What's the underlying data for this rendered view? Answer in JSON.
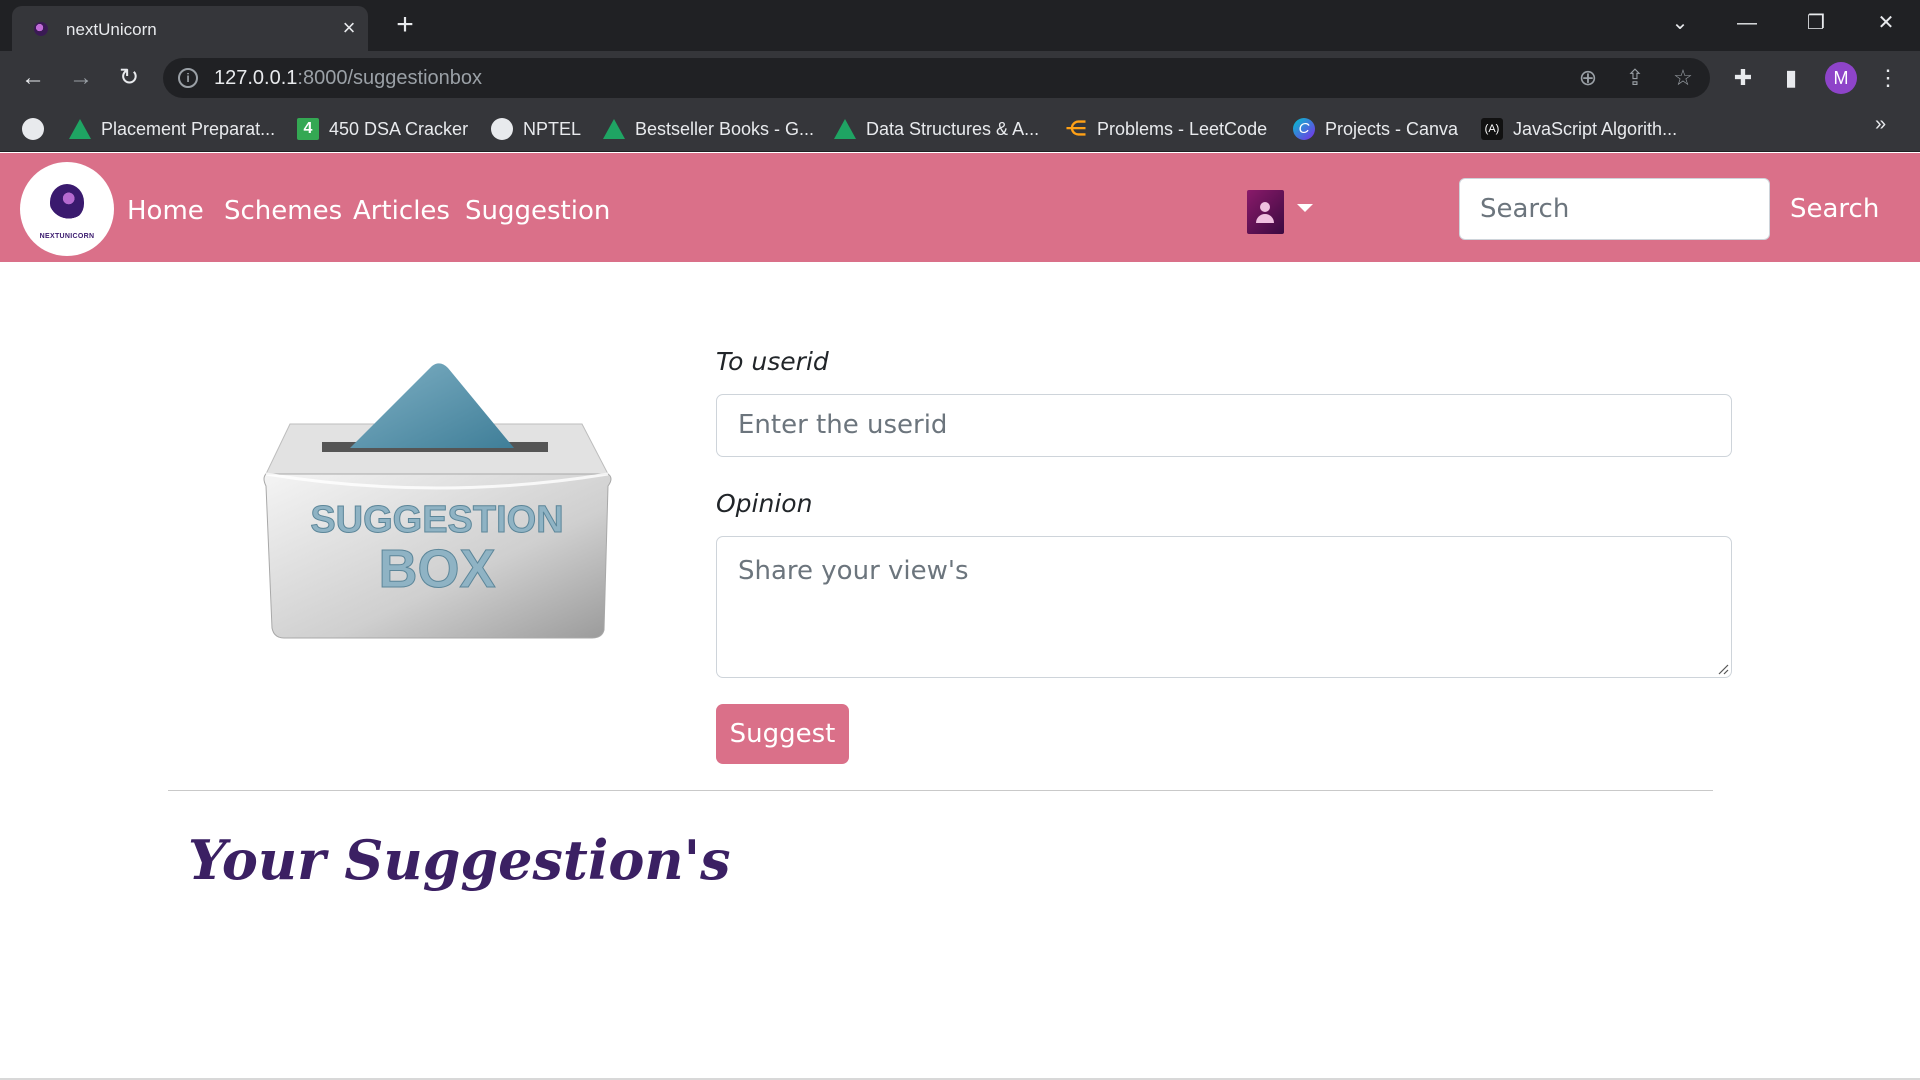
{
  "browser": {
    "tab_title": "nextUnicorn",
    "tab_close": "×",
    "new_tab": "+",
    "url_host": "127.0.0.1",
    "url_rest": ":8000/suggestionbox",
    "profile_initial": "M",
    "bookmarks": [
      "Placement Preparat...",
      "450 DSA Cracker",
      "NPTEL",
      "Bestseller Books - G...",
      "Data Structures & A...",
      "Problems - LeetCode",
      "Projects - Canva",
      "JavaScript Algorith..."
    ],
    "bookmark_more": "»",
    "dsa_badge": "4"
  },
  "navbar": {
    "links": [
      "Home",
      "Schemes",
      "Articles",
      "Suggestion"
    ],
    "search_placeholder": "Search",
    "search_button": "Search",
    "logo_text": "NEXTUNICORN"
  },
  "form": {
    "userid_label": "To userid",
    "userid_placeholder": "Enter the userid",
    "opinion_label": "Opinion",
    "opinion_placeholder": "Share your view's",
    "submit_label": "Suggest"
  },
  "illustration": {
    "line1": "SUGGESTION",
    "line2": "BOX"
  },
  "section": {
    "heading": "Your Suggestion's"
  },
  "colors": {
    "brand_pink": "#da7089",
    "heading_purple": "#3b2063"
  }
}
